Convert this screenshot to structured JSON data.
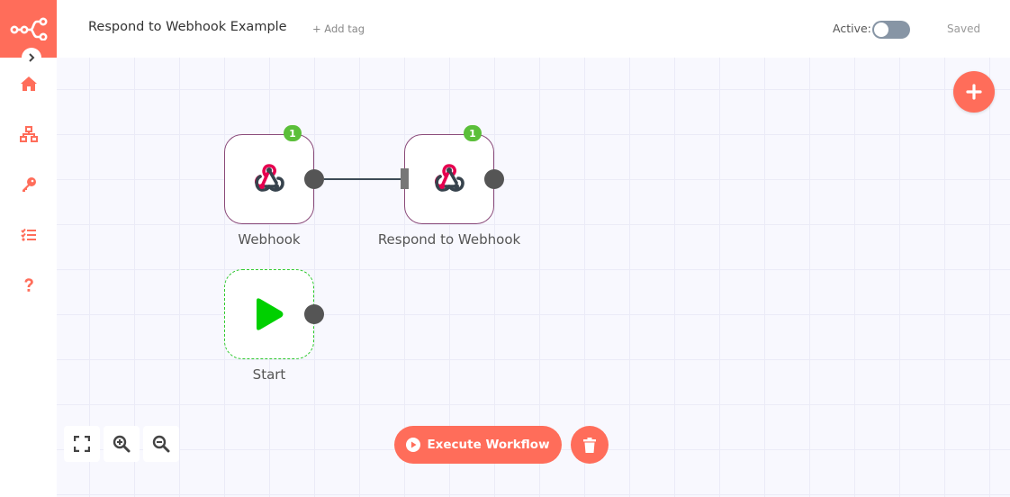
{
  "header": {
    "workflow_title": "Respond to Webhook Example",
    "add_tag_label": "+ Add tag",
    "active_label": "Active:",
    "active_state": false,
    "save_status": "Saved"
  },
  "brand": {
    "accent_color": "#ff6d5a",
    "success_color": "#5bbf3a"
  },
  "sidebar": {
    "items": [
      {
        "id": "home",
        "icon": "home-icon"
      },
      {
        "id": "workflows",
        "icon": "network-icon"
      },
      {
        "id": "credentials",
        "icon": "key-icon"
      },
      {
        "id": "executions",
        "icon": "tasks-icon"
      },
      {
        "id": "help",
        "icon": "question-icon"
      }
    ]
  },
  "nodes": [
    {
      "id": "webhook",
      "label": "Webhook",
      "icon": "webhook-icon",
      "badge": "1"
    },
    {
      "id": "respond",
      "label": "Respond to Webhook",
      "icon": "webhook-icon",
      "badge": "1"
    },
    {
      "id": "start",
      "label": "Start",
      "icon": "play-icon"
    }
  ],
  "connections": [
    {
      "from": "Webhook",
      "to": "Respond to Webhook"
    }
  ],
  "controls": {
    "execute_label": "Execute Workflow"
  }
}
